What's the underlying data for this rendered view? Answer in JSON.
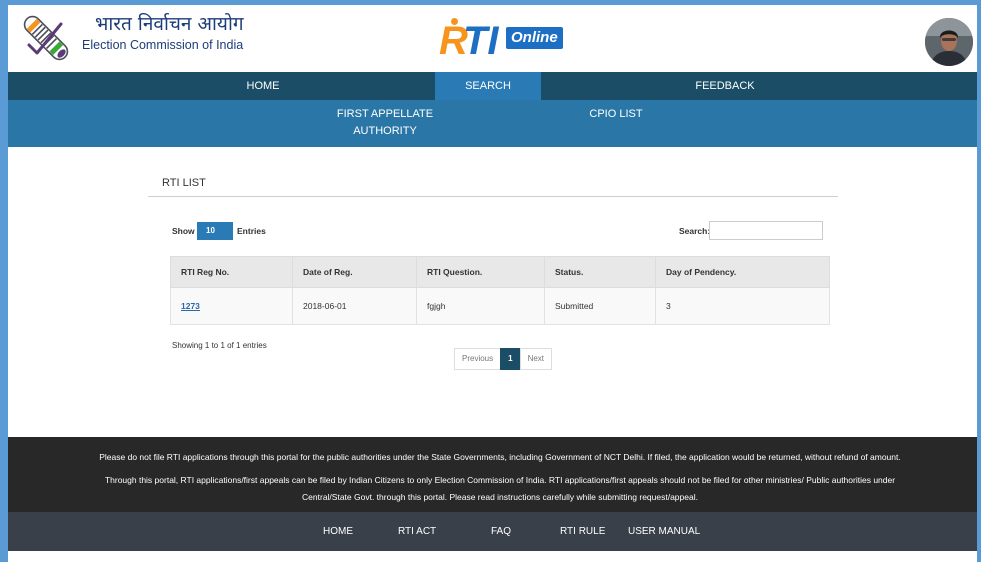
{
  "colors": {
    "frame": "#5b9bd5",
    "brand-navy": "#1d3c7a",
    "brand-orange": "#f7941d",
    "brand-blue": "#1d6fc4",
    "nav-dark": "#1c4d66",
    "nav-active": "#2a7bb5",
    "subnav": "#2a77a7",
    "link": "#2a6aa8",
    "footer": "#282828",
    "bottom-bar": "#394049"
  },
  "icons": {
    "org_logo": "eci-logo-icon",
    "app_logo_dot": "logo-dot-icon",
    "avatar": "user-avatar-icon"
  },
  "header": {
    "org_name_hindi": "भारत निर्वाचन आयोग",
    "org_name_english": "Election Commission of India",
    "app_logo": {
      "part_r": "R",
      "part_ti": "TI",
      "part_online": "Online"
    }
  },
  "nav": {
    "items": [
      {
        "label": "HOME",
        "active": false
      },
      {
        "label": "SEARCH",
        "active": true
      },
      {
        "label": "FEEDBACK",
        "active": false
      }
    ]
  },
  "subnav": {
    "items": [
      {
        "label": "FIRST APPELLATE AUTHORITY"
      },
      {
        "label": "CPIO LIST"
      }
    ]
  },
  "main": {
    "title": "RTI LIST",
    "length_menu": {
      "show_label": "Show",
      "value": "10",
      "entries_label": "Entries"
    },
    "search": {
      "label": "Search:",
      "value": ""
    },
    "table": {
      "columns": [
        "RTI Reg No.",
        "Date of Reg.",
        "RTI Question.",
        "Status.",
        "Day of Pendency."
      ],
      "rows": [
        [
          "1273",
          "2018-06-01",
          "fgjgh",
          "Submitted",
          "3"
        ]
      ]
    },
    "info": "Showing 1 to 1 of 1 entries",
    "pagination": {
      "previous": "Previous",
      "pages": [
        "1"
      ],
      "current": "1",
      "next": "Next"
    }
  },
  "footer": {
    "notice_lines": [
      "Please do not file RTI applications through this portal for the public authorities under the State Governments, including Government of NCT Delhi. If filed, the application would be returned, without refund of amount.",
      "Through this portal, RTI applications/first appeals can be filed by Indian Citizens to only Election Commission of India. RTI applications/first appeals should not be filed for other ministries/ Public authorities under",
      "Central/State Govt. through this portal. Please read instructions carefully while submitting request/appeal."
    ]
  },
  "bottom_nav": {
    "items": [
      "HOME",
      "RTI ACT",
      "FAQ",
      "RTI RULE",
      "USER MANUAL"
    ]
  }
}
